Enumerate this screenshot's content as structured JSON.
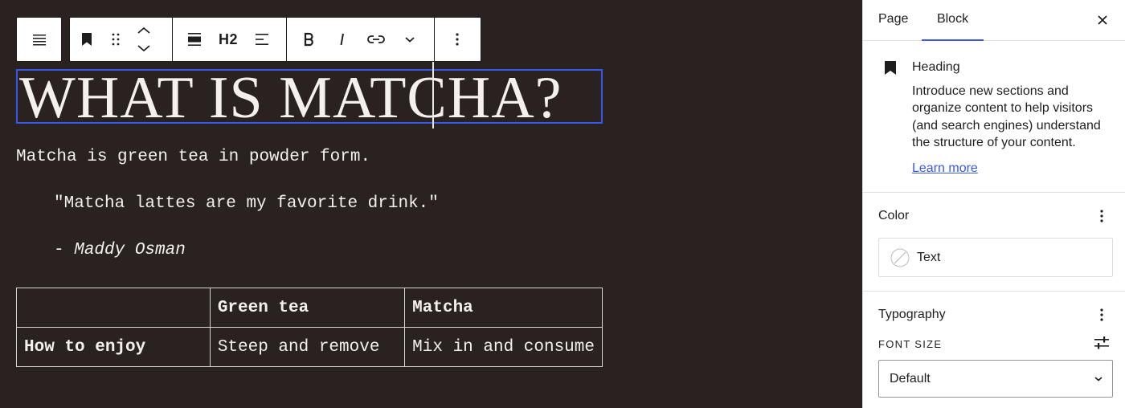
{
  "canvas": {
    "heading": "WHAT IS MATCHA?",
    "paragraph": "Matcha is green tea in powder form.",
    "quote": "\"Matcha lattes are my favorite drink.\"",
    "citation_dash": "- ",
    "citation_name": "Maddy Osman",
    "table": {
      "header": [
        "",
        "Green tea",
        "Matcha"
      ],
      "rows": [
        [
          "How to enjoy",
          "Steep and remove",
          "Mix in and consume"
        ]
      ]
    }
  },
  "toolbar": {
    "heading_level_label": "H2",
    "icons": [
      "align-justify-icon",
      "bookmark-icon",
      "drag-handle-icon",
      "move-up-icon",
      "move-down-icon",
      "block-align-icon",
      "text-align-icon",
      "bold-icon",
      "italic-icon",
      "link-icon",
      "more-chevron-icon",
      "options-icon"
    ]
  },
  "sidebar": {
    "tabs": [
      "Page",
      "Block"
    ],
    "active_tab": "Block",
    "block_card": {
      "title": "Heading",
      "description": "Introduce new sections and organize content to help visitors (and search engines) understand the structure of your content.",
      "link": "Learn more"
    },
    "color": {
      "title": "Color",
      "item_label": "Text"
    },
    "typography": {
      "title": "Typography",
      "font_size_label": "Font size",
      "font_size_value": "Default"
    }
  },
  "colors": {
    "canvas_bg": "#2a2121",
    "canvas_text": "#f4f1ec",
    "accent": "#3858e9",
    "sidebar_bg": "#ffffff"
  }
}
